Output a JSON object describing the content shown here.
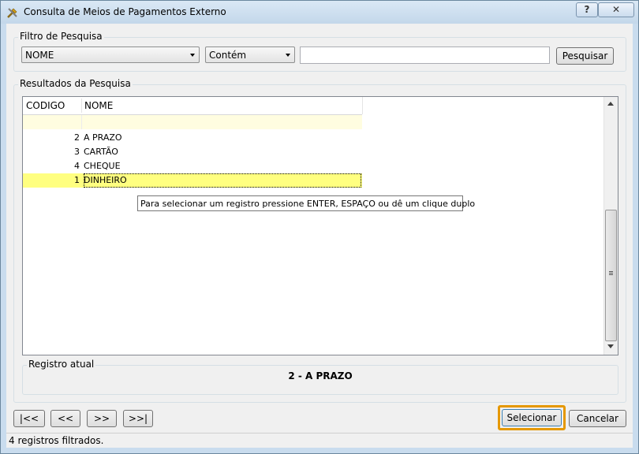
{
  "window": {
    "title": "Consulta de Meios de Pagamentos Externo",
    "help_label": "?",
    "close_label": "✕"
  },
  "filter": {
    "group_label": "Filtro de Pesquisa",
    "field_value": "NOME",
    "operator_value": "Contém",
    "search_value": "",
    "search_button": "Pesquisar"
  },
  "results": {
    "group_label": "Resultados da Pesquisa",
    "columns": [
      "CODIGO",
      "NOME"
    ],
    "rows": [
      {
        "code": "2",
        "name": "A PRAZO"
      },
      {
        "code": "3",
        "name": "CARTÃO"
      },
      {
        "code": "4",
        "name": "CHEQUE"
      },
      {
        "code": "1",
        "name": "DINHEIRO"
      }
    ],
    "tooltip": "Para selecionar um registro pressione ENTER, ESPAÇO ou dê um clique duplo"
  },
  "current": {
    "label": "Registro atual",
    "value": "2 - A PRAZO"
  },
  "nav": {
    "first": "|<<",
    "prev": "<<",
    "next": ">>",
    "last": ">>|"
  },
  "actions": {
    "select": "Selecionar",
    "cancel": "Cancelar"
  },
  "status": {
    "text": "4 registros filtrados."
  },
  "colors": {
    "highlight_row": "#ffff80",
    "selected_button_border": "#e59800",
    "filter_row": "#fffde0"
  }
}
